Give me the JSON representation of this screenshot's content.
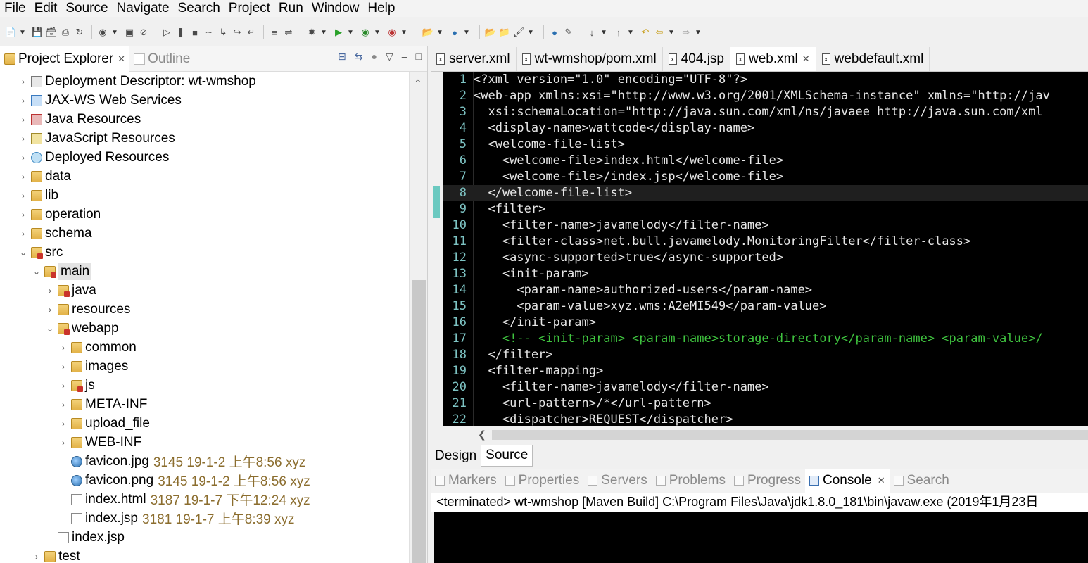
{
  "menu": [
    "File",
    "Edit",
    "Source",
    "Navigate",
    "Search",
    "Project",
    "Run",
    "Window",
    "Help"
  ],
  "left_tabs": {
    "project_explorer": "Project Explorer",
    "outline": "Outline"
  },
  "tree": [
    {
      "label": "Deployment Descriptor: wt-wmshop",
      "icon": "descriptor-icon",
      "indent": 0,
      "twisty": "collapsed"
    },
    {
      "label": "JAX-WS Web Services",
      "icon": "webservice-icon",
      "indent": 0,
      "twisty": "collapsed"
    },
    {
      "label": "Java Resources",
      "icon": "java-resources-icon",
      "indent": 0,
      "twisty": "collapsed"
    },
    {
      "label": "JavaScript Resources",
      "icon": "js-resources-icon",
      "indent": 0,
      "twisty": "collapsed"
    },
    {
      "label": "Deployed Resources",
      "icon": "deployed-resources-icon",
      "indent": 0,
      "twisty": "collapsed"
    },
    {
      "label": "data",
      "icon": "folder-icon",
      "indent": 0,
      "twisty": "collapsed"
    },
    {
      "label": "lib",
      "icon": "folder-icon",
      "indent": 0,
      "twisty": "collapsed"
    },
    {
      "label": "operation",
      "icon": "folder-icon",
      "indent": 0,
      "twisty": "collapsed"
    },
    {
      "label": "schema",
      "icon": "folder-icon",
      "indent": 0,
      "twisty": "collapsed"
    },
    {
      "label": "src",
      "icon": "source-folder-icon",
      "indent": 0,
      "twisty": "expanded"
    },
    {
      "label": "main",
      "icon": "source-folder-icon",
      "indent": 1,
      "twisty": "expanded",
      "selected": true
    },
    {
      "label": "java",
      "icon": "source-folder-icon",
      "indent": 2,
      "twisty": "collapsed"
    },
    {
      "label": "resources",
      "icon": "folder-icon",
      "indent": 2,
      "twisty": "collapsed"
    },
    {
      "label": "webapp",
      "icon": "source-folder-icon",
      "indent": 2,
      "twisty": "expanded"
    },
    {
      "label": "common",
      "icon": "folder-icon",
      "indent": 3,
      "twisty": "collapsed"
    },
    {
      "label": "images",
      "icon": "folder-icon",
      "indent": 3,
      "twisty": "collapsed"
    },
    {
      "label": "js",
      "icon": "source-folder-icon",
      "indent": 3,
      "twisty": "collapsed"
    },
    {
      "label": "META-INF",
      "icon": "folder-icon",
      "indent": 3,
      "twisty": "collapsed"
    },
    {
      "label": "upload_file",
      "icon": "folder-icon",
      "indent": 3,
      "twisty": "collapsed"
    },
    {
      "label": "WEB-INF",
      "icon": "folder-icon",
      "indent": 3,
      "twisty": "collapsed"
    },
    {
      "label": "favicon.jpg",
      "icon": "image-file-icon",
      "indent": 3,
      "twisty": "none",
      "meta": "3145  19-1-2 上午8:56  xyz"
    },
    {
      "label": "favicon.png",
      "icon": "image-file-icon",
      "indent": 3,
      "twisty": "none",
      "meta": "3145  19-1-2 上午8:56  xyz"
    },
    {
      "label": "index.html",
      "icon": "file-icon",
      "indent": 3,
      "twisty": "none",
      "meta": "3187  19-1-7 下午12:24  xyz"
    },
    {
      "label": "index.jsp",
      "icon": "file-icon",
      "indent": 3,
      "twisty": "none",
      "meta": "3181  19-1-7 上午8:39  xyz"
    },
    {
      "label": "index.jsp",
      "icon": "file-icon",
      "indent": 2,
      "twisty": "none"
    },
    {
      "label": "test",
      "icon": "folder-icon",
      "indent": 1,
      "twisty": "collapsed"
    }
  ],
  "editor_tabs": [
    {
      "label": "server.xml",
      "active": false
    },
    {
      "label": "wt-wmshop/pom.xml",
      "active": false
    },
    {
      "label": "404.jsp",
      "active": false
    },
    {
      "label": "web.xml",
      "active": true
    },
    {
      "label": "webdefault.xml",
      "active": false
    }
  ],
  "code_lines": [
    {
      "n": "1",
      "fold": false,
      "text": "<?xml version=\"1.0\" encoding=\"UTF-8\"?>"
    },
    {
      "n": "2",
      "fold": true,
      "text": "<web-app xmlns:xsi=\"http://www.w3.org/2001/XMLSchema-instance\" xmlns=\"http://jav"
    },
    {
      "n": "3",
      "fold": false,
      "text": "  xsi:schemaLocation=\"http://java.sun.com/xml/ns/javaee http://java.sun.com/xml"
    },
    {
      "n": "4",
      "fold": false,
      "text": "  <display-name>wattcode</display-name>"
    },
    {
      "n": "5",
      "fold": true,
      "text": "  <welcome-file-list>"
    },
    {
      "n": "6",
      "fold": false,
      "text": "    <welcome-file>index.html</welcome-file>"
    },
    {
      "n": "7",
      "fold": false,
      "text": "    <welcome-file>/index.jsp</welcome-file>"
    },
    {
      "n": "8",
      "fold": true,
      "text": "  </welcome-file-list>",
      "cursor": true
    },
    {
      "n": "9",
      "fold": true,
      "text": "  <filter>"
    },
    {
      "n": "10",
      "fold": false,
      "text": "    <filter-name>javamelody</filter-name>"
    },
    {
      "n": "11",
      "fold": false,
      "text": "    <filter-class>net.bull.javamelody.MonitoringFilter</filter-class>"
    },
    {
      "n": "12",
      "fold": false,
      "text": "    <async-supported>true</async-supported>"
    },
    {
      "n": "13",
      "fold": true,
      "text": "    <init-param>"
    },
    {
      "n": "14",
      "fold": false,
      "text": "      <param-name>authorized-users</param-name>"
    },
    {
      "n": "15",
      "fold": false,
      "text": "      <param-value>xyz.wms:A2eMI549</param-value>"
    },
    {
      "n": "16",
      "fold": false,
      "text": "    </init-param>"
    },
    {
      "n": "17",
      "fold": false,
      "text": "    <!-- <init-param> <param-name>storage-directory</param-name> <param-value>/",
      "comment": true
    },
    {
      "n": "18",
      "fold": false,
      "text": "  </filter>"
    },
    {
      "n": "19",
      "fold": true,
      "text": "  <filter-mapping>"
    },
    {
      "n": "20",
      "fold": false,
      "text": "    <filter-name>javamelody</filter-name>"
    },
    {
      "n": "21",
      "fold": false,
      "text": "    <url-pattern>/*</url-pattern>"
    },
    {
      "n": "22",
      "fold": false,
      "text": "    <dispatcher>REQUEST</dispatcher>"
    }
  ],
  "design_source_tabs": {
    "design": "Design",
    "source": "Source"
  },
  "console_tabs": [
    {
      "label": "Markers",
      "active": false
    },
    {
      "label": "Properties",
      "active": false
    },
    {
      "label": "Servers",
      "active": false
    },
    {
      "label": "Problems",
      "active": false
    },
    {
      "label": "Progress",
      "active": false
    },
    {
      "label": "Console",
      "active": true
    },
    {
      "label": "Search",
      "active": false
    }
  ],
  "console_status": "<terminated> wt-wmshop [Maven Build] C:\\Program Files\\Java\\jdk1.8.0_181\\bin\\javaw.exe (2019年1月23日",
  "colors": {
    "editor_bg": "#000000",
    "tag": "#e6e6e6",
    "attr_value": "#e6e6e6",
    "comment": "#3fc33f",
    "line_number": "#7dc3c3",
    "tree_meta": "#8b6d2e"
  }
}
